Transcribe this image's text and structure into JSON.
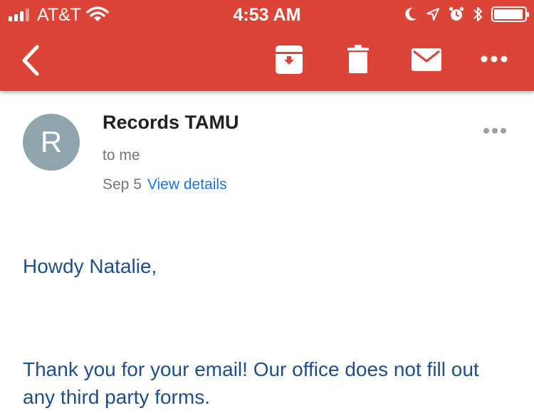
{
  "status_bar": {
    "carrier": "AT&T",
    "time": "4:53 AM",
    "icons": [
      "signal-bars-icon",
      "wifi-icon",
      "moon-icon",
      "location-arrow-icon",
      "alarm-icon",
      "bluetooth-icon",
      "battery-icon"
    ]
  },
  "toolbar": {
    "background": "#db4437",
    "icons": [
      "back-arrow-icon",
      "archive-icon",
      "trash-icon",
      "mail-icon",
      "more-horizontal-icon"
    ]
  },
  "message": {
    "avatar_letter": "R",
    "avatar_color": "#90a4ae",
    "sender": "Records TAMU",
    "recipient": "to me",
    "date": "Sep 5",
    "view_details": "View details",
    "greeting": "Howdy Natalie,",
    "body": "Thank you for your email! Our office does not fill out any third party forms."
  }
}
